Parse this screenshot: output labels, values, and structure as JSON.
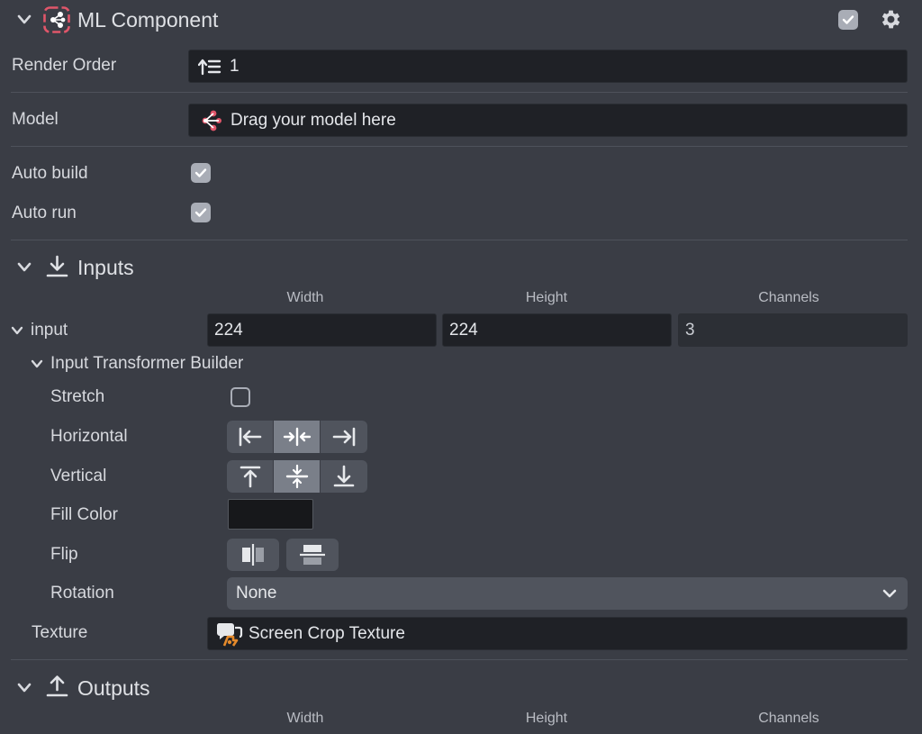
{
  "component": {
    "title": "ML Component",
    "enabled": true
  },
  "render_order": {
    "label": "Render Order",
    "value": "1"
  },
  "model": {
    "label": "Model",
    "placeholder": "Drag your model here"
  },
  "auto_build": {
    "label": "Auto build",
    "checked": true
  },
  "auto_run": {
    "label": "Auto run",
    "checked": true
  },
  "inputs": {
    "title": "Inputs",
    "columns": [
      "Width",
      "Height",
      "Channels"
    ],
    "input": {
      "name": "input",
      "width": "224",
      "height": "224",
      "channels": "3"
    },
    "transformer": {
      "title": "Input Transformer Builder",
      "stretch_label": "Stretch",
      "stretch_checked": false,
      "horizontal_label": "Horizontal",
      "horizontal_selected": "center",
      "vertical_label": "Vertical",
      "vertical_selected": "center",
      "fill_color_label": "Fill Color",
      "fill_color": "#17181b",
      "flip_label": "Flip",
      "rotation_label": "Rotation",
      "rotation_value": "None"
    },
    "texture": {
      "label": "Texture",
      "value": "Screen Crop Texture"
    }
  },
  "outputs": {
    "title": "Outputs",
    "columns": [
      "Width",
      "Height",
      "Channels"
    ]
  },
  "colors": {
    "panel_bg": "#3a3d45",
    "field_bg": "#1f2126",
    "accent_red": "#e0566a",
    "texture_orange": "#e58a2b"
  },
  "icons": {
    "collapse": "chevron-down-icon",
    "component": "ml-component-icon",
    "settings": "gear-icon",
    "render_order": "render-order-icon",
    "model": "ml-model-icon",
    "inputs": "download-icon",
    "outputs": "upload-icon",
    "texture": "texture-icon"
  }
}
